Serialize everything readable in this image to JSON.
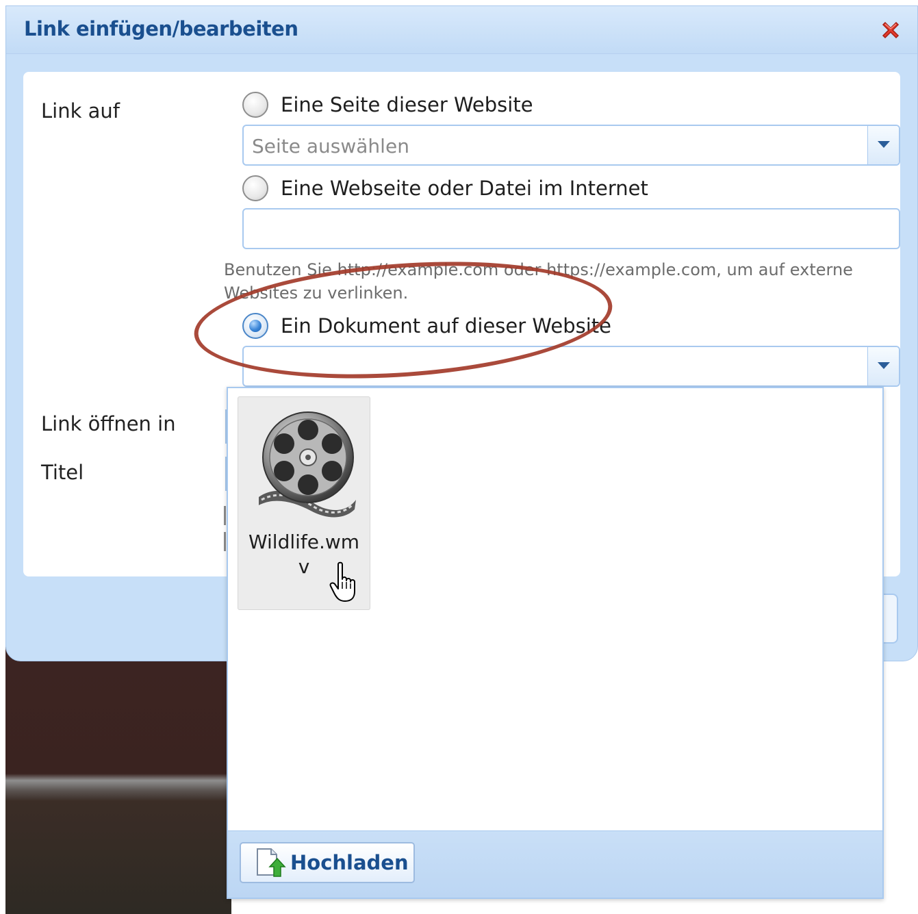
{
  "dialog": {
    "title": "Link einfügen/bearbeiten",
    "close_icon": "close-icon"
  },
  "form": {
    "link_label": "Link auf",
    "open_in_label": "Link öffnen in",
    "title_label": "Titel",
    "options": [
      {
        "label": "Eine Seite dieser Website",
        "checked": false
      },
      {
        "label": "Eine Webseite oder Datei im Internet",
        "checked": false
      },
      {
        "label": "Ein Dokument auf dieser Website",
        "checked": true
      }
    ],
    "page_select": {
      "placeholder": "Seite auswählen",
      "value": ""
    },
    "url_input": {
      "value": ""
    },
    "url_hint": "Benutzen Sie http://example.com oder https://example.com, um auf externe Websites zu verlinken.",
    "document_select": {
      "value": ""
    }
  },
  "document_picker": {
    "files": [
      {
        "name": "Wildlife.wmv",
        "icon": "film-reel-icon"
      }
    ],
    "upload_label": "Hochladen",
    "upload_icon": "upload-icon"
  },
  "colors": {
    "title": "#1a4f8f",
    "dialog_bg": "#c7dff8",
    "annotation": "#a33b2a",
    "radio_checked": "#3b86d8"
  }
}
